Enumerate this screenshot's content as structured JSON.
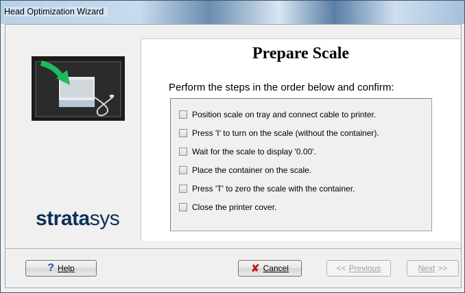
{
  "window": {
    "title": "Head Optimization Wizard"
  },
  "logo": {
    "bold": "strata",
    "light": "sys"
  },
  "content": {
    "heading": "Prepare Scale",
    "instruction": "Perform the steps in the order below and confirm:",
    "steps": [
      {
        "label": "Position scale on tray and connect cable to printer.",
        "checked": false
      },
      {
        "label": "Press 'I' to turn on the scale (without the container).",
        "checked": false
      },
      {
        "label": "Wait for the scale to display '0.00'.",
        "checked": false
      },
      {
        "label": "Place the container on the scale.",
        "checked": false
      },
      {
        "label": "Press 'T' to zero the scale with the container.",
        "checked": false
      },
      {
        "label": "Close the printer cover.",
        "checked": false
      }
    ]
  },
  "buttons": {
    "help": {
      "label": "Help",
      "mnemonic": "H"
    },
    "cancel": {
      "label": "Cancel",
      "mnemonic": "C"
    },
    "previous": {
      "label": "Previous",
      "mnemonic": "P",
      "enabled": false
    },
    "next": {
      "label": "Next",
      "mnemonic": "N",
      "enabled": false
    }
  }
}
